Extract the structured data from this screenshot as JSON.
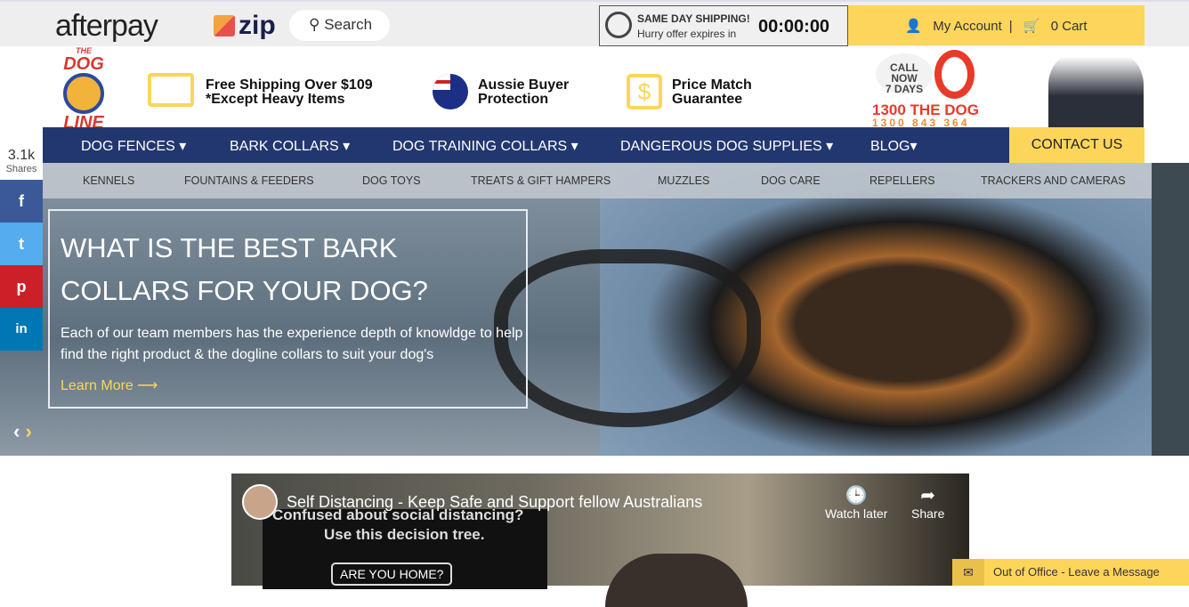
{
  "topbar": {
    "afterpay": "afterpay",
    "zip": "zip",
    "search_label": "Search",
    "timer_title": "SAME DAY SHIPPING!",
    "timer_sub": "Hurry offer expires in",
    "timer_value": "00:00:00",
    "my_account": "My Account",
    "cart": "0 Cart"
  },
  "header": {
    "logo_top": "THE",
    "logo_mid": "DOG",
    "logo_bottom": "LINE",
    "features": [
      {
        "line1": "Free Shipping Over $109",
        "line2": "*Except Heavy Items",
        "icon": "truck-icon"
      },
      {
        "line1": "Aussie Buyer",
        "line2": "Protection",
        "icon": "australia-flag-icon"
      },
      {
        "line1": "Price Match",
        "line2": "Guarantee",
        "icon": "dollar-icon"
      }
    ],
    "call_now": "CALL NOW",
    "days": "7 DAYS",
    "phone_words": "1300 THE DOG",
    "phone_number": "1300 843 364"
  },
  "nav": {
    "items": [
      "DOG FENCES ▾",
      "BARK COLLARS ▾",
      "DOG TRAINING COLLARS ▾",
      "DANGEROUS DOG SUPPLIES ▾",
      "BLOG▾"
    ],
    "contact": "CONTACT US"
  },
  "subnav": {
    "items": [
      "KENNELS",
      "FOUNTAINS & FEEDERS",
      "DOG TOYS",
      "TREATS & GIFT HAMPERS",
      "MUZZLES",
      "DOG CARE",
      "REPELLERS",
      "TRACKERS AND CAMERAS"
    ]
  },
  "hero": {
    "title": "WHAT IS THE BEST BARK COLLARS FOR YOUR DOG?",
    "text": "Each of our team members has the experience depth of knowldge to help find the right product & the dogline collars to suit your dog's",
    "learn_more": "Learn More ⟶",
    "prev": "‹",
    "next": "›"
  },
  "share": {
    "count": "3.1k",
    "label": "Shares",
    "buttons": [
      "f",
      "t",
      "p",
      "in"
    ],
    "colors": [
      "#3b5998",
      "#55acee",
      "#cb2027",
      "#0077b5"
    ]
  },
  "video": {
    "title": "Self Distancing - Keep Safe and Support fellow Australians",
    "overlay1": "Confused about social distancing?",
    "overlay2": "Use this decision tree.",
    "box": "ARE YOU HOME?",
    "watch_later": "Watch later",
    "share": "Share"
  },
  "chat": {
    "label": "Out of Office - Leave a Message"
  },
  "colors": {
    "navy": "#22376f",
    "yellow": "#fdd55a"
  }
}
